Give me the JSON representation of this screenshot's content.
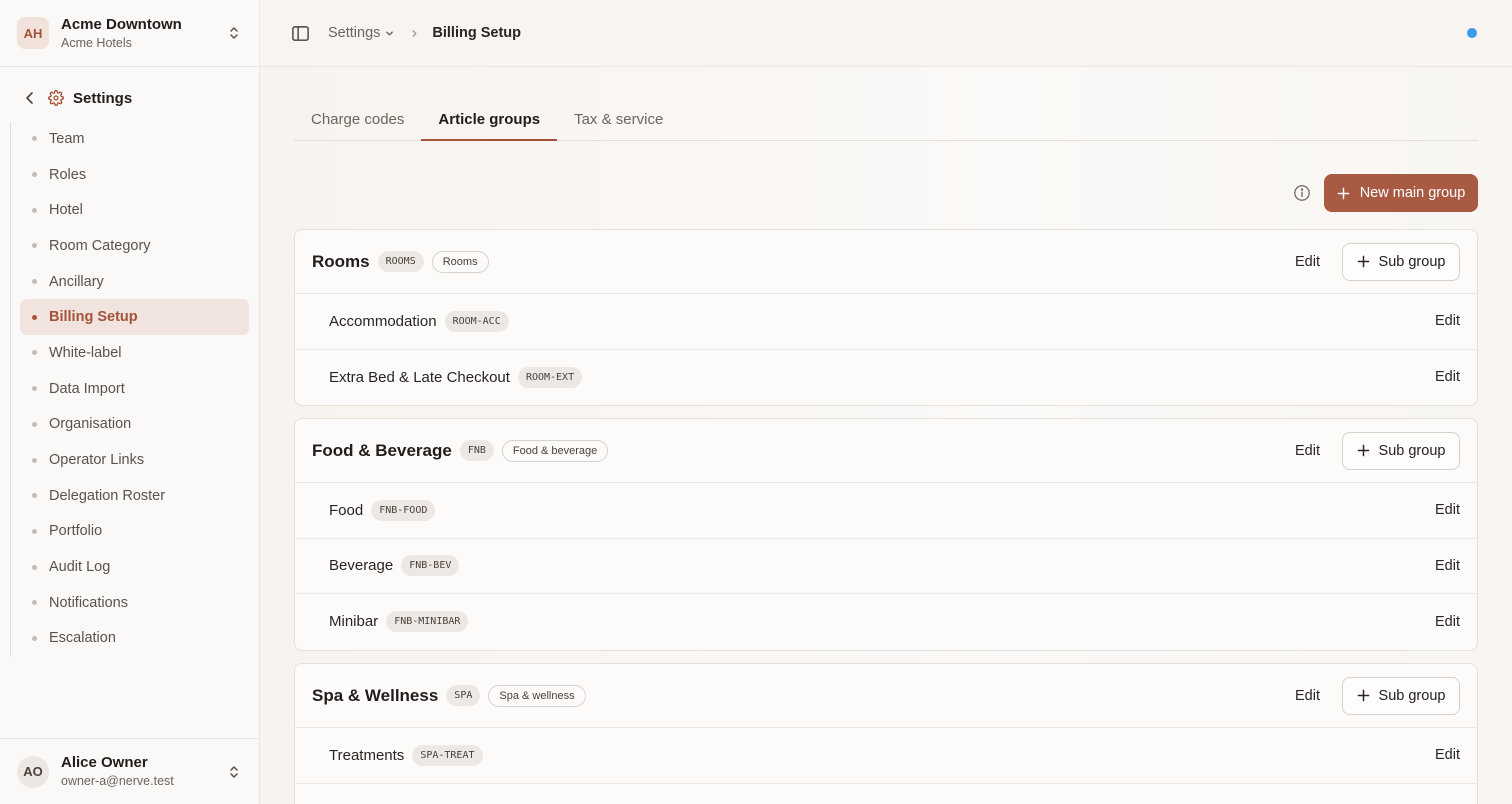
{
  "org": {
    "initials": "AH",
    "name": "Acme Downtown",
    "sub": "Acme Hotels"
  },
  "settings_label": "Settings",
  "nav": [
    {
      "label": "Team"
    },
    {
      "label": "Roles"
    },
    {
      "label": "Hotel"
    },
    {
      "label": "Room Category"
    },
    {
      "label": "Ancillary"
    },
    {
      "label": "Billing Setup",
      "active": true
    },
    {
      "label": "White-label"
    },
    {
      "label": "Data Import"
    },
    {
      "label": "Organisation"
    },
    {
      "label": "Operator Links"
    },
    {
      "label": "Delegation Roster"
    },
    {
      "label": "Portfolio"
    },
    {
      "label": "Audit Log"
    },
    {
      "label": "Notifications"
    },
    {
      "label": "Escalation"
    }
  ],
  "user": {
    "initials": "AO",
    "name": "Alice Owner",
    "email": "owner-a@nerve.test"
  },
  "breadcrumb": {
    "parent": "Settings",
    "current": "Billing Setup"
  },
  "tabs": [
    {
      "label": "Charge codes"
    },
    {
      "label": "Article groups",
      "active": true
    },
    {
      "label": "Tax & service"
    }
  ],
  "new_main_group": "New main group",
  "edit_label": "Edit",
  "sub_group_label": "Sub group",
  "groups": [
    {
      "title": "Rooms",
      "code": "ROOMS",
      "category": "Rooms",
      "subs": [
        {
          "name": "Accommodation",
          "code": "ROOM-ACC"
        },
        {
          "name": "Extra Bed & Late Checkout",
          "code": "ROOM-EXT"
        }
      ]
    },
    {
      "title": "Food & Beverage",
      "code": "FNB",
      "category": "Food & beverage",
      "subs": [
        {
          "name": "Food",
          "code": "FNB-FOOD"
        },
        {
          "name": "Beverage",
          "code": "FNB-BEV"
        },
        {
          "name": "Minibar",
          "code": "FNB-MINIBAR"
        }
      ]
    },
    {
      "title": "Spa & Wellness",
      "code": "SPA",
      "category": "Spa & wellness",
      "subs": [
        {
          "name": "Treatments",
          "code": "SPA-TREAT"
        },
        {
          "name": "",
          "code": ""
        }
      ]
    }
  ],
  "colors": {
    "accent": "#a85a43",
    "status_dot": "#3b99e6"
  }
}
